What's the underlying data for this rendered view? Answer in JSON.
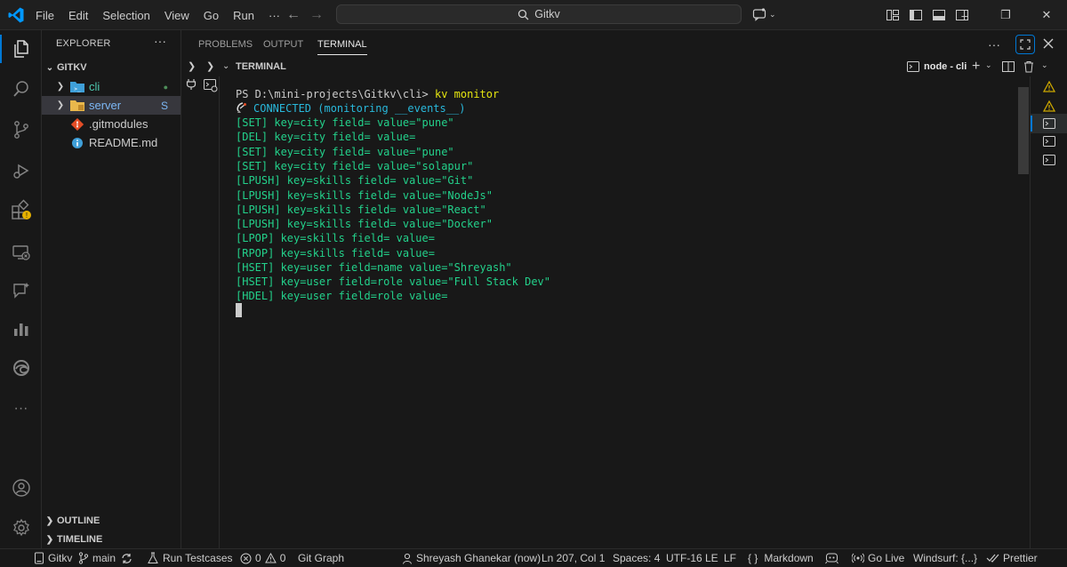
{
  "titlebar": {
    "menu": [
      "File",
      "Edit",
      "Selection",
      "View",
      "Go",
      "Run",
      "···"
    ],
    "search_text": "Gitkv"
  },
  "sidebar": {
    "header": "EXPLORER",
    "more": "···",
    "root": "GITKV",
    "items": [
      {
        "label": "cli",
        "icon": "folder-icon",
        "status": "●",
        "color": "#4ec9b0"
      },
      {
        "label": "server",
        "icon": "folder-icon",
        "status": "S",
        "color": "#7cb7f4"
      },
      {
        "label": ".gitmodules",
        "icon": "git-icon",
        "status": ""
      },
      {
        "label": "README.md",
        "icon": "info-icon",
        "status": ""
      }
    ],
    "outline": "OUTLINE",
    "timeline": "TIMELINE"
  },
  "panel": {
    "tabs": [
      "PROBLEMS",
      "OUTPUT",
      "TERMINAL"
    ],
    "active_tab": "TERMINAL",
    "more": "···",
    "section_title": "TERMINAL",
    "terminal_name": "node - cli"
  },
  "terminal": {
    "prompt": "PS D:\\mini-projects\\Gitkv\\cli> ",
    "command": "kv monitor",
    "connected": "CONNECTED (monitoring __events__)",
    "lines": [
      "[SET] key=city field= value=\"pune\"",
      "[DEL] key=city field= value=",
      "[SET] key=city field= value=\"pune\"",
      "[SET] key=city field= value=\"solapur\"",
      "[LPUSH] key=skills field= value=\"Git\"",
      "[LPUSH] key=skills field= value=\"NodeJs\"",
      "[LPUSH] key=skills field= value=\"React\"",
      "[LPUSH] key=skills field= value=\"Docker\"",
      "[LPOP] key=skills field= value=",
      "[RPOP] key=skills field= value=",
      "[HSET] key=user field=name value=\"Shreyash\"",
      "[HSET] key=user field=role value=\"Full Stack Dev\"",
      "[HDEL] key=user field=role value="
    ]
  },
  "statusbar": {
    "repo": "Gitkv",
    "branch": "main",
    "run_testcases": "Run Testcases",
    "errors": "0",
    "warnings": "0",
    "git_graph": "Git Graph",
    "blame": "Shreyash Ghanekar (now)",
    "position": "Ln 207, Col 1",
    "spaces": "Spaces: 4",
    "encoding": "UTF-16 LE",
    "eol": "LF",
    "braces": "{ }",
    "language": "Markdown",
    "go_live": "Go Live",
    "windsurf": "Windsurf: {...}",
    "prettier": "Prettier"
  }
}
